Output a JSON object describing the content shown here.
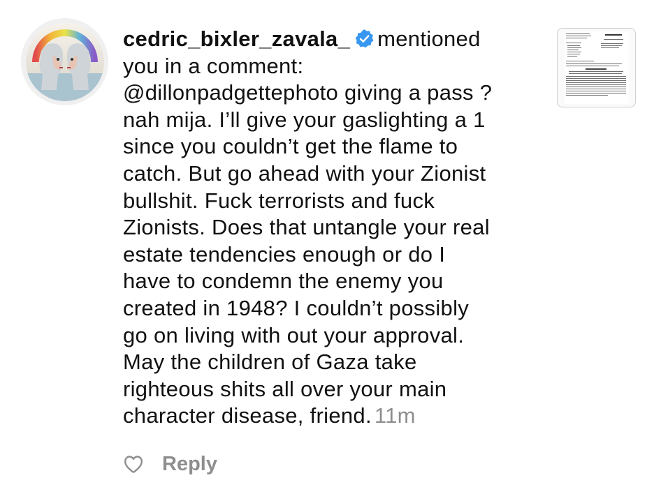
{
  "notification": {
    "username": "cedric_bixler_zavala_",
    "verified": true,
    "action_text": "mentioned",
    "comment_lines": [
      "you in a comment:",
      "@dillonpadgettephoto giving a pass ?",
      "nah mija. I’ll give your gaslighting a 1",
      "since you couldn’t get the flame to",
      "catch. But go ahead with your Zionist",
      "bullshit. Fuck terrorists and fuck",
      "Zionists. Does that untangle your real",
      "estate tendencies enough or do I",
      "have to condemn the enemy you",
      "created in 1948? I couldn’t possibly",
      "go on living with out your approval.",
      "May the children of Gaza take",
      "righteous shits all over your main"
    ],
    "last_line": "character disease, friend.",
    "timestamp": "11m",
    "reply_label": "Reply"
  },
  "icons": {
    "verified": "verified-badge-icon",
    "like": "heart-outline-icon"
  },
  "colors": {
    "text": "#111111",
    "muted": "#8e8e8e",
    "verified_blue": "#3897f0"
  }
}
